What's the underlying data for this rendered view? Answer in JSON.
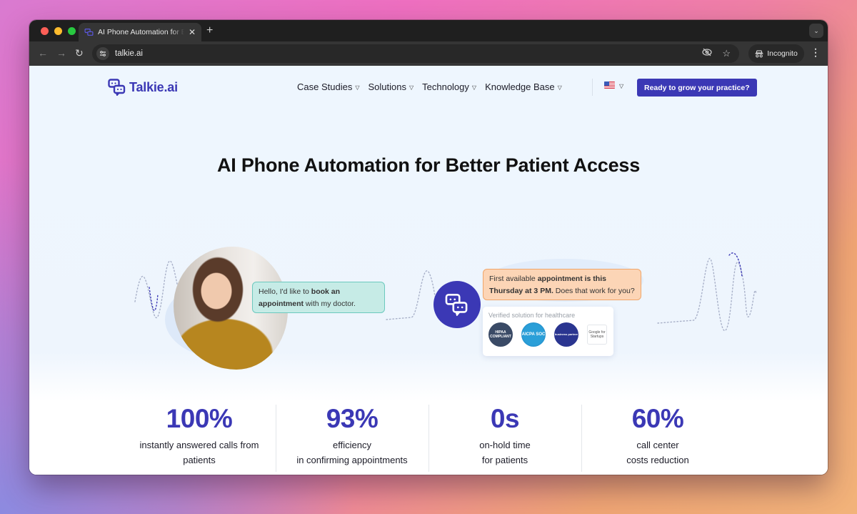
{
  "browser": {
    "tab_title": "AI Phone Automation for Better Patient Access",
    "url": "talkie.ai",
    "incognito_label": "Incognito",
    "new_tab_symbol": "+",
    "close_symbol": "✕"
  },
  "header": {
    "logo_text": "Talkie.ai",
    "nav": [
      {
        "label": "Case Studies"
      },
      {
        "label": "Solutions"
      },
      {
        "label": "Technology"
      },
      {
        "label": "Knowledge Base"
      }
    ],
    "language": "en-US",
    "cta_label": "Ready to grow your practice?"
  },
  "hero": {
    "title": "AI Phone Automation for Better Patient Access",
    "patient_bubble": {
      "prefix": "Hello, I'd like to ",
      "bold1": "book an appointment",
      "suffix": " with my doctor."
    },
    "bot_bubble": {
      "prefix": "First available ",
      "bold": "appointment is this Thursday at 3 PM.",
      "suffix": " Does that work for you?"
    },
    "certifications": {
      "label": "Verified solution for healthcare",
      "badges": [
        {
          "name": "HIPAA",
          "text": "HIPAA COMPLIANT"
        },
        {
          "name": "AICPA SOC",
          "text": "AICPA SOC"
        },
        {
          "name": "Business partner",
          "text": "business partner"
        },
        {
          "name": "Google for Startups",
          "text": "Google for Startups"
        }
      ]
    }
  },
  "stats": [
    {
      "value": "100%",
      "line1": "instantly answered calls from",
      "line2": "patients"
    },
    {
      "value": "93%",
      "line1": "efficiency",
      "line2": "in confirming appointments"
    },
    {
      "value": "0s",
      "line1": "on-hold time",
      "line2": "for patients"
    },
    {
      "value": "60%",
      "line1": "call center",
      "line2": "costs reduction"
    }
  ],
  "colors": {
    "brand": "#3b38b5",
    "patient_bubble": "#c6ebe6",
    "bot_bubble": "#fcd5b6"
  }
}
